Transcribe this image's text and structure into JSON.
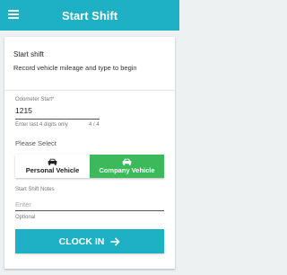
{
  "appbar": {
    "title": "Start Shift",
    "menu_icon": "hamburger-menu-icon",
    "color": "#1eb0c4"
  },
  "header": {
    "title": "Start shift",
    "subtitle": "Record vehicle mileage and type to begin"
  },
  "odometer": {
    "label": "Odometer Start*",
    "value": "1215",
    "helper": "Enter last 4 digits only",
    "counter": "4 / 4"
  },
  "vehicle_select": {
    "label": "Please Select",
    "options": [
      {
        "label": "Personal Vehicle",
        "icon": "car-icon",
        "selected": false
      },
      {
        "label": "Company Vehicle",
        "icon": "car-icon",
        "selected": true
      }
    ],
    "selected_color": "#3cb95a"
  },
  "notes": {
    "label": "Start Shift Notes",
    "placeholder": "Enter",
    "helper": "Optional"
  },
  "clock_in": {
    "label": "CLOCK IN",
    "icon": "arrow-right-icon"
  }
}
